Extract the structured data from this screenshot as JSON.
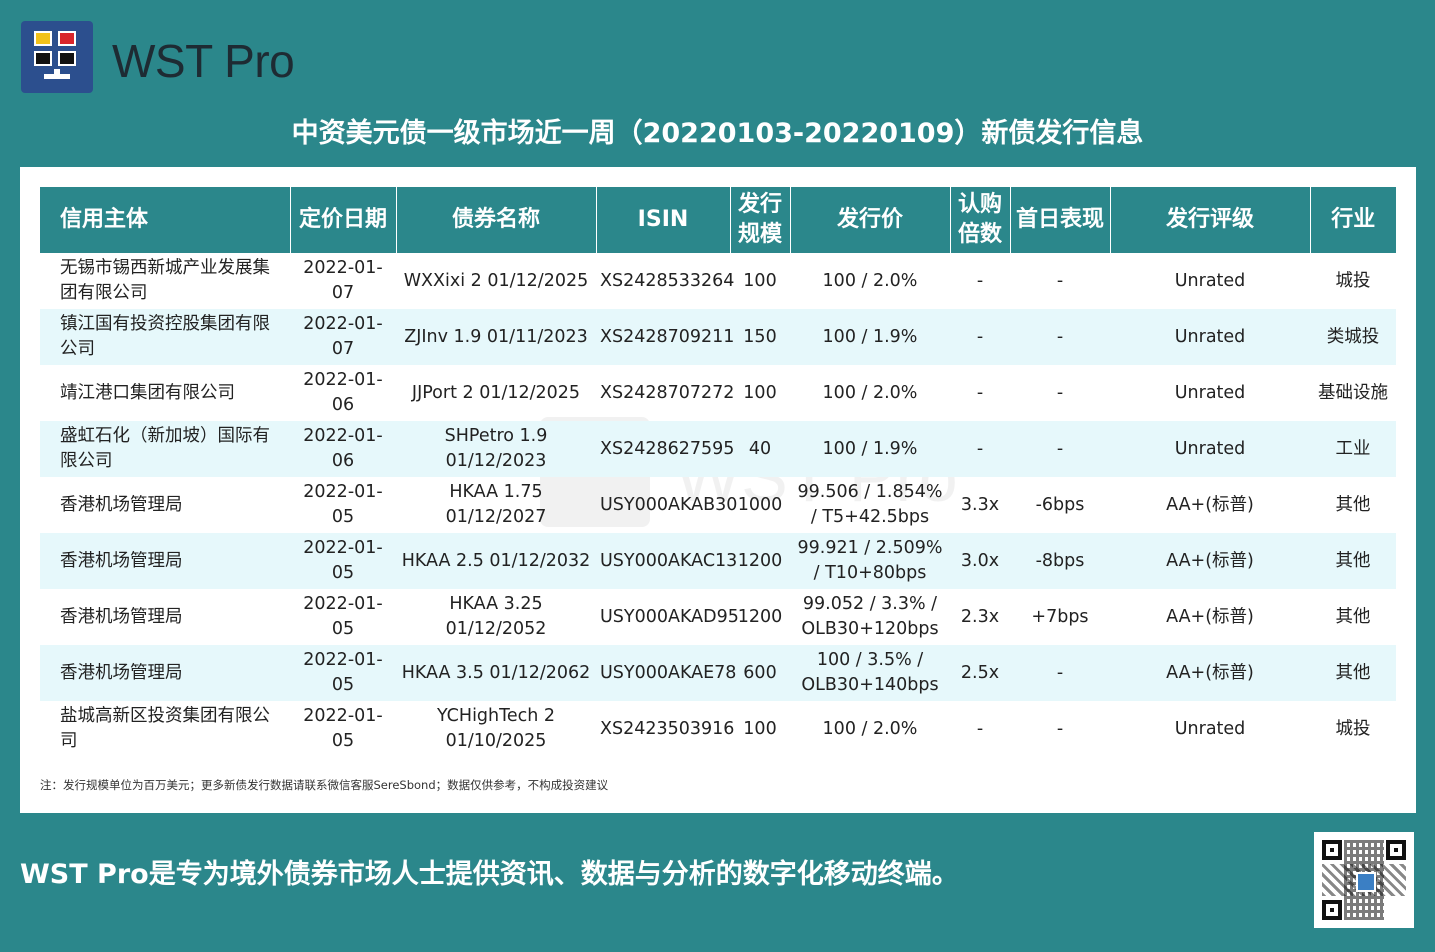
{
  "header": {
    "brand": "WST Pro",
    "title": "中资美元债一级市场近一周（20220103-20220109）新债发行信息"
  },
  "table": {
    "columns": [
      "信用主体",
      "定价日期",
      "债券名称",
      "ISIN",
      "发行\n规模",
      "发行价",
      "认购\n倍数",
      "首日表现",
      "发行评级",
      "行业"
    ],
    "rows": [
      {
        "issuer": "无锡市锡西新城产业发展集团有限公司",
        "date": "2022-01-07",
        "name": "WXXixi 2 01/12/2025",
        "isin": "XS2428533264",
        "size": "100",
        "price": "100 / 2.0%",
        "cover": "-",
        "perf": "-",
        "rating": "Unrated",
        "industry": "城投"
      },
      {
        "issuer": "镇江国有投资控股集团有限公司",
        "date": "2022-01-07",
        "name": "ZJInv 1.9 01/11/2023",
        "isin": "XS2428709211",
        "size": "150",
        "price": "100 / 1.9%",
        "cover": "-",
        "perf": "-",
        "rating": "Unrated",
        "industry": "类城投"
      },
      {
        "issuer": "靖江港口集团有限公司",
        "date": "2022-01-06",
        "name": "JJPort 2 01/12/2025",
        "isin": "XS2428707272",
        "size": "100",
        "price": "100 / 2.0%",
        "cover": "-",
        "perf": "-",
        "rating": "Unrated",
        "industry": "基础设施"
      },
      {
        "issuer": "盛虹石化（新加坡）国际有限公司",
        "date": "2022-01-06",
        "name": "SHPetro 1.9 01/12/2023",
        "isin": "XS2428627595",
        "size": "40",
        "price": "100 / 1.9%",
        "cover": "-",
        "perf": "-",
        "rating": "Unrated",
        "industry": "工业"
      },
      {
        "issuer": "香港机场管理局",
        "date": "2022-01-05",
        "name": "HKAA 1.75 01/12/2027",
        "isin": "USY000AKAB30",
        "size": "1000",
        "price": "99.506 / 1.854% / T5+42.5bps",
        "cover": "3.3x",
        "perf": "-6bps",
        "rating": "AA+(标普)",
        "industry": "其他"
      },
      {
        "issuer": "香港机场管理局",
        "date": "2022-01-05",
        "name": "HKAA 2.5 01/12/2032",
        "isin": "USY000AKAC13",
        "size": "1200",
        "price": "99.921 / 2.509% / T10+80bps",
        "cover": "3.0x",
        "perf": "-8bps",
        "rating": "AA+(标普)",
        "industry": "其他"
      },
      {
        "issuer": "香港机场管理局",
        "date": "2022-01-05",
        "name": "HKAA 3.25 01/12/2052",
        "isin": "USY000AKAD95",
        "size": "1200",
        "price": "99.052 / 3.3% / OLB30+120bps",
        "cover": "2.3x",
        "perf": "+7bps",
        "rating": "AA+(标普)",
        "industry": "其他"
      },
      {
        "issuer": "香港机场管理局",
        "date": "2022-01-05",
        "name": "HKAA 3.5 01/12/2062",
        "isin": "USY000AKAE78",
        "size": "600",
        "price": "100 / 3.5% / OLB30+140bps",
        "cover": "2.5x",
        "perf": "-",
        "rating": "AA+(标普)",
        "industry": "其他"
      },
      {
        "issuer": "盐城高新区投资集团有限公司",
        "date": "2022-01-05",
        "name": "YCHighTech 2 01/10/2025",
        "isin": "XS2423503916",
        "size": "100",
        "price": "100 / 2.0%",
        "cover": "-",
        "perf": "-",
        "rating": "Unrated",
        "industry": "城投"
      }
    ]
  },
  "note": "注：发行规模单位为百万美元；更多新债发行数据请联系微信客服SereSbond；数据仅供参考，不构成投资建议",
  "watermark": "WST Pro",
  "footer": {
    "slogan": "WST Pro是专为境外债券市场人士提供资讯、数据与分析的数字化移动终端。"
  }
}
